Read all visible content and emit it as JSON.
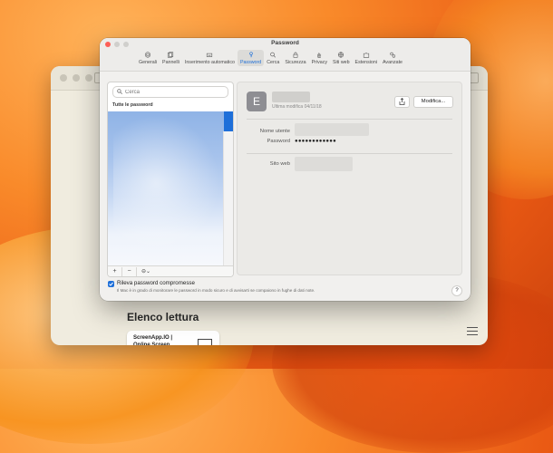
{
  "window": {
    "title": "Password"
  },
  "tabs": [
    {
      "label": "Generali",
      "icon": "gear-icon"
    },
    {
      "label": "Pannelli",
      "icon": "tabs-icon"
    },
    {
      "label": "Inserimento automatico",
      "icon": "autofill-icon"
    },
    {
      "label": "Password",
      "icon": "key-icon",
      "active": true
    },
    {
      "label": "Cerca",
      "icon": "search-icon"
    },
    {
      "label": "Sicurezza",
      "icon": "lock-icon"
    },
    {
      "label": "Privacy",
      "icon": "hand-icon"
    },
    {
      "label": "Siti web",
      "icon": "globe-icon"
    },
    {
      "label": "Estensioni",
      "icon": "puzzle-icon"
    },
    {
      "label": "Avanzate",
      "icon": "gears-icon"
    }
  ],
  "sidebar": {
    "search_placeholder": "Cerca",
    "section_header": "Tutte le password",
    "add_label": "+",
    "remove_label": "−",
    "more_label": "⊖⌄"
  },
  "detail": {
    "avatar_letter": "E",
    "last_modified": "Ultima modifica 04/11/18",
    "edit_label": "Modifica...",
    "username_label": "Nome utente",
    "password_label": "Password",
    "password_value": "●●●●●●●●●●●●",
    "website_label": "Sito web"
  },
  "footer": {
    "checkbox_label": "Rileva password compromesse",
    "description": "Il Mac è in grado di monitorare le password in modo sicuro e di avvisarti se compaiono in fughe di dati note.",
    "help_label": "?"
  },
  "background": {
    "reading_list_title": "Elenco lettura",
    "reading_card_text": "ScreenApp.IO | Online Screen Recorder..."
  },
  "colors": {
    "accent": "#1e6fd9",
    "close": "#fd5f57"
  }
}
